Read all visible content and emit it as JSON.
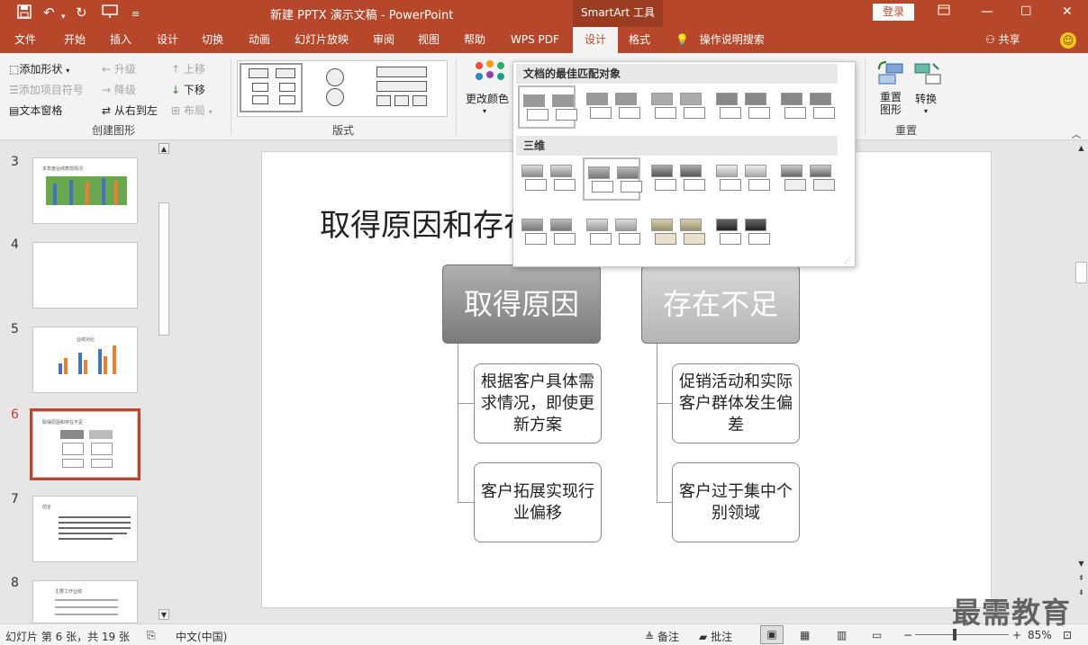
{
  "title_bar": {
    "doc_title": "新建 PPTX 演示文稿 - PowerPoint",
    "context_tool": "SmartArt 工具",
    "login": "登录"
  },
  "tabs": [
    "文件",
    "开始",
    "插入",
    "设计",
    "切换",
    "动画",
    "幻灯片放映",
    "审阅",
    "视图",
    "帮助",
    "WPS PDF",
    "设计",
    "格式"
  ],
  "help_search": "操作说明搜索",
  "share": "共享",
  "ribbon": {
    "create_group": {
      "add_shape": "添加形状",
      "add_bullet": "添加项目符号",
      "text_pane": "文本窗格",
      "promote": "升级",
      "demote": "降级",
      "right_to_left": "从右到左",
      "move_up": "上移",
      "move_down": "下移",
      "layout": "布局",
      "label": "创建图形"
    },
    "layouts_label": "版式",
    "change_colors": "更改颜色",
    "reset_group": {
      "reset_graphic": "重置图形",
      "convert": "转换",
      "label": "重置"
    }
  },
  "styles_dropdown": {
    "best_match_header": "文档的最佳匹配对象",
    "three_d_header": "三维"
  },
  "slides": [
    {
      "num": "3",
      "title": "本年度业绩表现情况"
    },
    {
      "num": "4",
      "title": ""
    },
    {
      "num": "5",
      "title": "业绩对比"
    },
    {
      "num": "6",
      "title": "取得原因和存在不足"
    },
    {
      "num": "7",
      "title": "前言"
    },
    {
      "num": "8",
      "title": "主要工作业绩"
    }
  ],
  "slide": {
    "title": "取得原因和存在不足",
    "left_header": "取得原因",
    "right_header": "存在不足",
    "left_items": [
      "根据客户具体需求情况，即使更新方案",
      "客户拓展实现行业偏移"
    ],
    "right_items": [
      "促销活动和实际客户群体发生偏差",
      "客户过于集中个别领域"
    ]
  },
  "status": {
    "slide_info": "幻灯片 第 6 张，共 19 张",
    "language": "中文(中国)",
    "notes": "备注",
    "comments": "批注",
    "zoom": "85%"
  },
  "watermark": "最需教育",
  "colors": {
    "accent": "#b7472a",
    "active_thumb": "#c0442b"
  }
}
